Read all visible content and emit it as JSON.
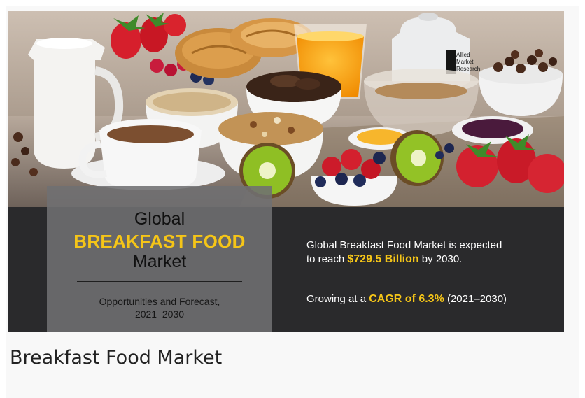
{
  "banner": {
    "headline_top": "Global",
    "headline_main": "BREAKFAST FOOD",
    "headline_bottom": "Market",
    "subtitle_line1": "Opportunities and Forecast,",
    "subtitle_line2": "2021–2030",
    "stat1_prefix": "Global Breakfast Food Market is expected",
    "stat2_prefix": "to reach ",
    "stat2_value": "$729.5 Billion",
    "stat2_suffix": " by 2030.",
    "stat3_prefix": "Growing at a ",
    "stat3_value": "CAGR of 6.3%",
    "stat3_suffix": " (2021–2030)",
    "logo_text_1": "Allied",
    "logo_text_2": "Market",
    "logo_text_3": "Research",
    "accent_color": "#f5c518",
    "dark_color": "#2a2a2c"
  },
  "caption": "Breakfast Food Market"
}
